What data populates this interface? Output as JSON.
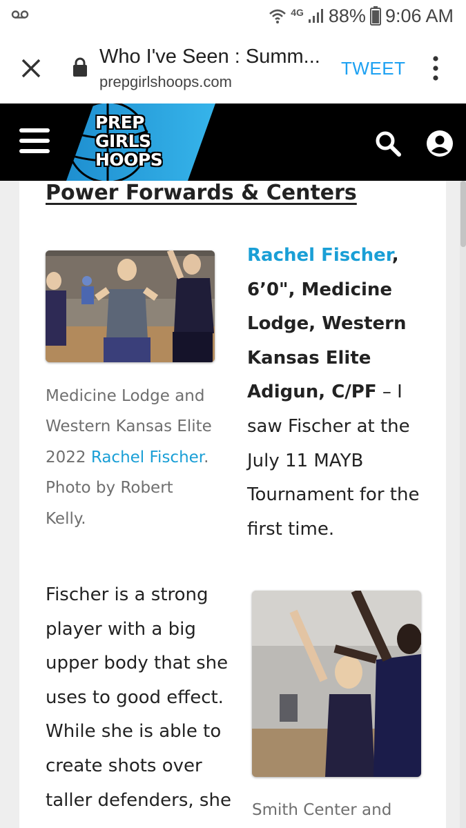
{
  "status_bar": {
    "network": "4G",
    "battery": "88%",
    "time": "9:06 AM"
  },
  "browser": {
    "page_title": "Who I've Seen : Summ...",
    "domain": "prepgirlshoops.com",
    "tweet_label": "TWEET"
  },
  "site": {
    "logo_lines": [
      "PREP",
      "GIRLS",
      "HOOPS"
    ],
    "colors": {
      "brand_blue": "#29a8e0",
      "header_bg": "#000000",
      "link": "#1a9fd6"
    }
  },
  "article": {
    "section_heading": "Power Forwards & Centers",
    "player": {
      "name": "Rachel Fischer",
      "details": ", 6’0\", Medicine Lodge, Western Kansas Elite Adigun, C/PF",
      "blurb": " – I saw Fischer at the July 11 MAYB Tournament for the first time."
    },
    "photo1_caption": {
      "before": "Medicine Lodge and Western Kansas Elite 2022 ",
      "link": "Rachel Fischer",
      "after": ". Photo by Robert Kelly."
    },
    "body": "Fischer is a strong player with a big upper body that she uses to good effect.  While she is able to create shots over taller defenders, she",
    "photo2_caption": "Smith Center and"
  }
}
